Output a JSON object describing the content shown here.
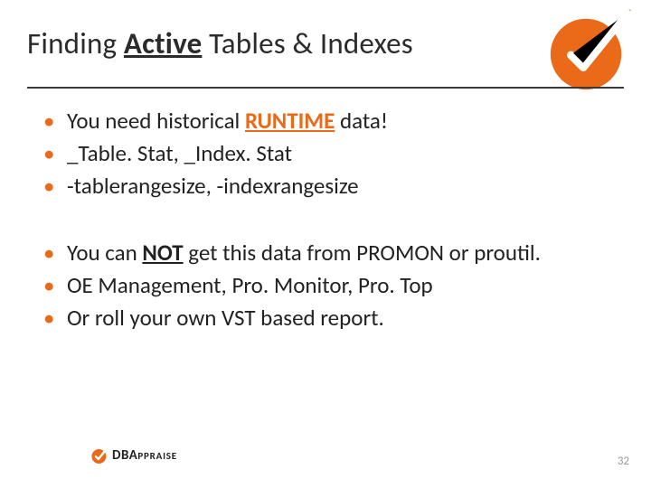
{
  "title": {
    "prefix": "Finding ",
    "emph": "Active",
    "suffix": " Tables & Indexes"
  },
  "bullets_group1": [
    {
      "pre": "You need historical ",
      "emph": "RUNTIME",
      "post": " data!",
      "emph_class": "orange-bold"
    },
    {
      "pre": "_Table. Stat, _Index. Stat",
      "emph": "",
      "post": "",
      "emph_class": ""
    },
    {
      "pre": "-tablerangesize, -indexrangesize",
      "emph": "",
      "post": "",
      "emph_class": ""
    }
  ],
  "bullets_group2": [
    {
      "pre": "You can ",
      "emph": "NOT",
      "post": " get this data from PROMON or proutil.",
      "emph_class": "black-bold"
    },
    {
      "pre": "OE Management, Pro. Monitor, Pro. Top",
      "emph": "",
      "post": "",
      "emph_class": ""
    },
    {
      "pre": "Or roll your own VST based report.",
      "emph": "",
      "post": "",
      "emph_class": ""
    }
  ],
  "footer_brand": {
    "db": "DBA",
    "rest": "PPRAISE"
  },
  "page_number": "32",
  "colors": {
    "accent": "#ea6a1a"
  }
}
